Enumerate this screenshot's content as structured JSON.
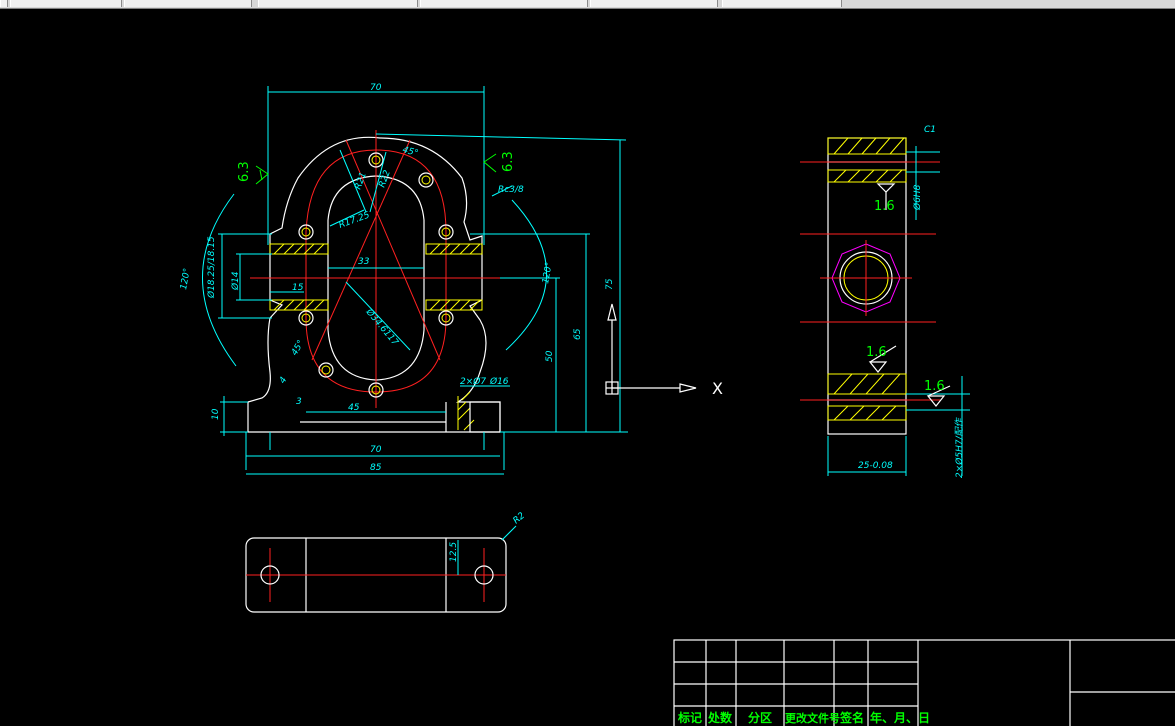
{
  "toolbar": {
    "segments": [
      "",
      "",
      "",
      "",
      "",
      ""
    ]
  },
  "colors": {
    "background": "#000000",
    "outline": "#ffffff",
    "dimension": "#00ffff",
    "centerline": "#ff2020",
    "hatch": "#ffff00",
    "roughness": "#00ff00",
    "hidden": "#ff00ff"
  },
  "front_view": {
    "dims": {
      "top_width": "70",
      "angle_45": "45°",
      "r_upper_left": "R21",
      "r_upper_right": "R22",
      "r_inner": "R17.25",
      "center_gap": "33",
      "left_inner": "15",
      "port_dia": "Ø14",
      "port_range": "Ø18.25/18.15",
      "arc_120_left": "120°",
      "arc_120_right": "120°",
      "diag_dia": "Ø34.6117",
      "angle_45_lower": "45°",
      "hole_small": "4",
      "thread": "Rc3/8",
      "vert_50": "50",
      "vert_65": "65",
      "vert_75": "75",
      "base_45": "45",
      "base_3": "3",
      "base_10": "10",
      "bottom_70": "70",
      "bottom_85": "85",
      "hole_note": "2×Ø7",
      "counterbore": "Ø16"
    },
    "roughness_left": "6.3",
    "roughness_right": "6.3"
  },
  "side_view": {
    "dims": {
      "chamfer": "C1",
      "bore": "Ø6H8",
      "width": "25",
      "width_tol": "25-0.08",
      "hole_note": "2×Ø5H7/配作"
    },
    "roughness_1": "1.6",
    "roughness_2": "1.6",
    "roughness_3": "1.6"
  },
  "bottom_view": {
    "dims": {
      "radius": "R2",
      "height": "12.5"
    }
  },
  "ucs": {
    "x_label": "X"
  },
  "title_block": {
    "headers": [
      "标记",
      "处数",
      "分区",
      "更改文件号",
      "签名",
      "年、月、日"
    ]
  }
}
